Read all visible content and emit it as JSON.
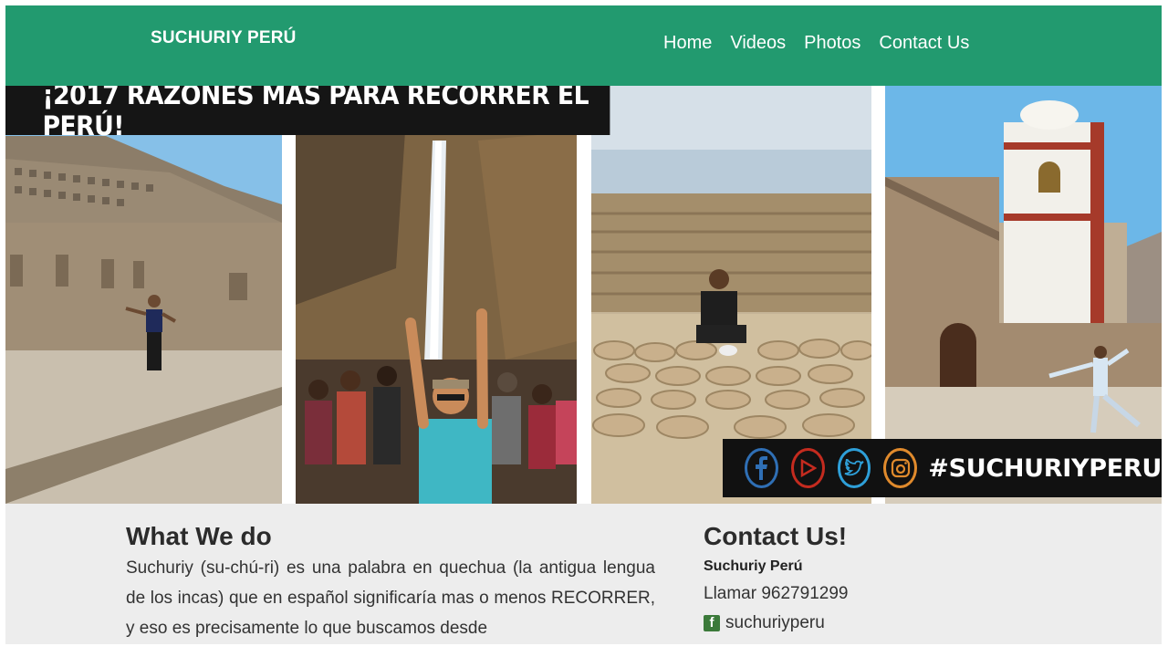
{
  "header": {
    "brand": "SUCHURIY PERÚ",
    "nav": [
      {
        "label": "Home"
      },
      {
        "label": "Videos"
      },
      {
        "label": "Photos"
      },
      {
        "label": "Contact Us"
      }
    ]
  },
  "hero": {
    "banner_text": "¡2017 RAZONES MÁS PARA RECORRER EL PERÚ!",
    "social_icons": [
      "facebook-icon",
      "youtube-icon",
      "twitter-icon",
      "instagram-icon"
    ],
    "hashtag": "#SUCHURIYPERU"
  },
  "what_we_do": {
    "title": "What We do",
    "body": "Suchuriy (su-chú-ri) es una palabra en quechua (la antigua lengua de los incas) que en español significaría mas o menos RECORRER, y eso es precisamente lo que buscamos desde"
  },
  "contact": {
    "title": "Contact Us!",
    "name": "Suchuriy Perú",
    "phone": "Llamar 962791299",
    "facebook": "suchuriyperu"
  },
  "colors": {
    "header_green": "#229a6f",
    "content_bg": "#ededed"
  }
}
